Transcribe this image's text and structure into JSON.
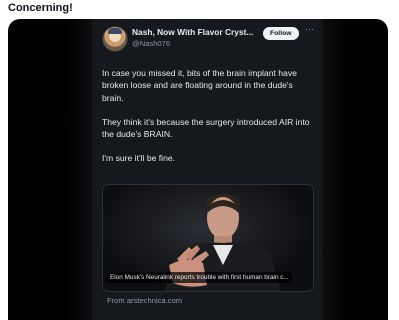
{
  "post": {
    "caption": "Concerning!"
  },
  "tweet": {
    "display_name": "Nash, Now With Flavor Cryst...",
    "handle": "@Nash076",
    "follow_label": "Follow",
    "more_glyph": "···",
    "paragraphs": [
      "In case you missed it, bits of the brain implant have broken loose and are floating around in the dude's brain.",
      "They think it's because the surgery introduced AIR into the dude's BRAIN.",
      "I'm sure it'll be fine."
    ]
  },
  "link_card": {
    "title": "Elon Musk's Neuralink reports trouble with first human brain c...",
    "source": "From arstechnica.com"
  },
  "colors": {
    "card_background": "#15181c",
    "primary_text": "#e7e9ea",
    "secondary_text": "#8b98a5",
    "follow_button_bg": "#eff3f4"
  }
}
